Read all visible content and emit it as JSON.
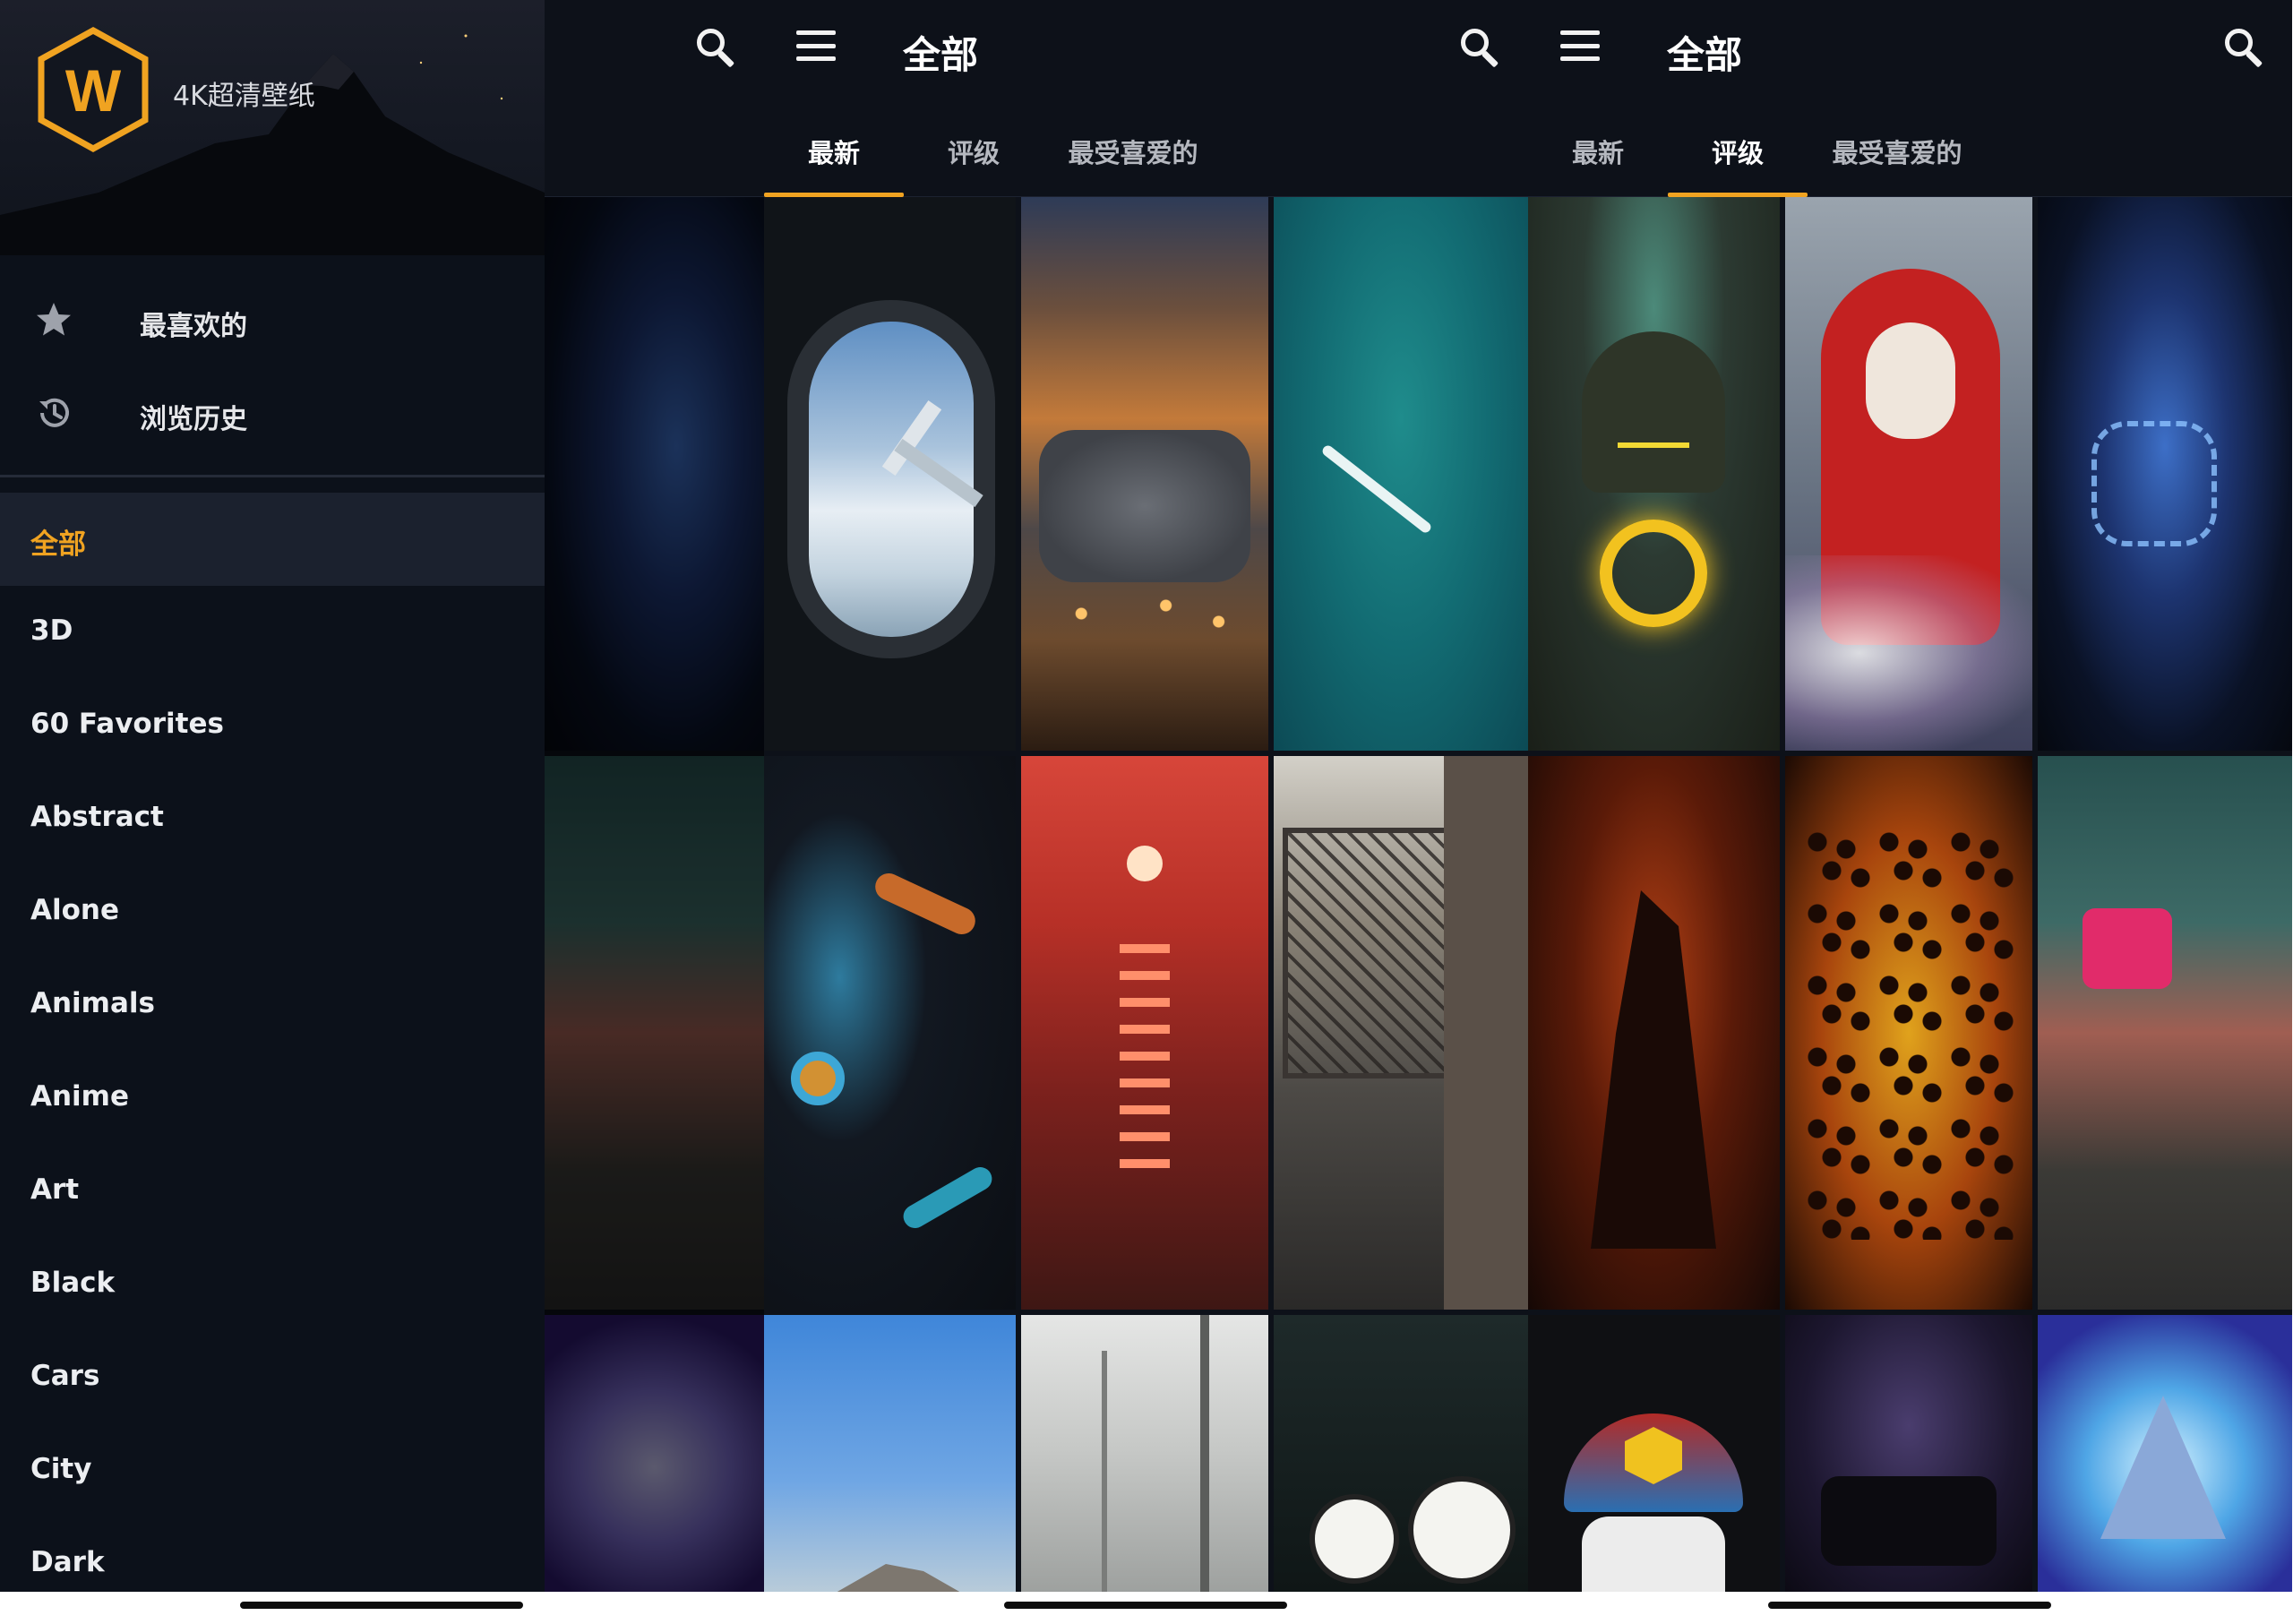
{
  "app": {
    "title": "全部",
    "brand_name": "4K超清壁纸",
    "logo_letter": "W",
    "accent_color": "#f0a321",
    "background_color": "#0d1119"
  },
  "tabs": [
    "最新",
    "评级",
    "最受喜爱的"
  ],
  "screens": [
    {
      "id": "drawer-open",
      "active_tab": 0
    },
    {
      "id": "latest",
      "active_tab": 0
    },
    {
      "id": "rated",
      "active_tab": 1
    }
  ],
  "drawer": {
    "items": [
      {
        "label": "最喜欢的",
        "icon": "star-icon"
      },
      {
        "label": "浏览历史",
        "icon": "history-icon"
      }
    ],
    "categories": [
      "全部",
      "3D",
      "60 Favorites",
      "Abstract",
      "Alone",
      "Animals",
      "Anime",
      "Art",
      "Black",
      "Cars",
      "City",
      "Dark"
    ],
    "selected_category": "全部"
  },
  "icons": {
    "menu": "hamburger-menu-icon",
    "search": "search-icon"
  },
  "wallpapers": {
    "latest": [
      "hooded-neon-mask",
      "airplane-window",
      "cookies-string-lights",
      "ocean-speedboat",
      "masked-figure-smoke",
      "fluid-abstract-art",
      "red-sunset-sea",
      "brooklyn-bridge",
      "moon-wolf",
      "blue-sky-mountain",
      "misty-forest",
      "station-clock"
    ],
    "rated": [
      "neon-hoodie-portal",
      "anonymous-mask-red-hood",
      "hooded-neon-mask",
      "howling-wolf-fire",
      "leopard-fire",
      "masked-figure-smoke",
      "skull-cap-w",
      "anime-silence-mask",
      "moon-wolf"
    ]
  }
}
